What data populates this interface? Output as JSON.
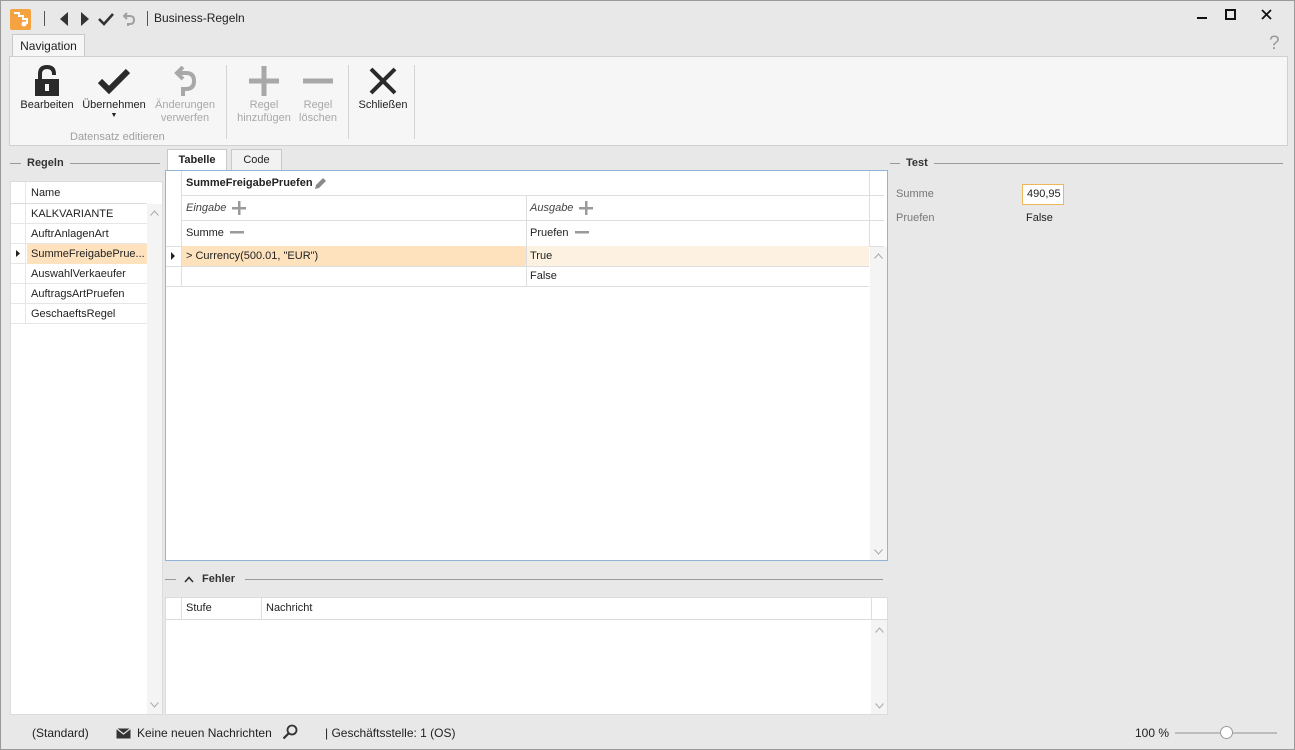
{
  "window": {
    "title": "Business-Regeln",
    "accent_color": "#f4a340"
  },
  "ribbon": {
    "tab": "Navigation",
    "buttons": {
      "edit": "Bearbeiten",
      "apply": "Übernehmen",
      "discard_line1": "Änderungen",
      "discard_line2": "verwerfen",
      "add_rule_line1": "Regel",
      "add_rule_line2": "hinzufügen",
      "delete_rule_line1": "Regel",
      "delete_rule_line2": "löschen",
      "close": "Schließen"
    },
    "group_label": "Datensatz editieren"
  },
  "rules_panel": {
    "header": "Regeln",
    "column": "Name",
    "items": [
      "KALKVARIANTE",
      "AuftrAnlagenArt",
      "SummeFreigabePruefen",
      "AuswahlVerkaeufer",
      "AuftragsArtPruefen",
      "GeschaeftsRegel"
    ],
    "selected_display": "SummeFreigabePrue..."
  },
  "tabs": [
    "Tabelle",
    "Code"
  ],
  "decision_table": {
    "name": "SummeFreigabePruefen",
    "input_label": "Eingabe",
    "output_label": "Ausgabe",
    "input_column": "Summe",
    "output_column": "Pruefen",
    "rows": [
      {
        "input": "> Currency(500.01, \"EUR\")",
        "output": "True"
      },
      {
        "input": "",
        "output": "False"
      }
    ],
    "selected_color": "#fde2bd"
  },
  "errors": {
    "header": "Fehler",
    "columns": [
      "Stufe",
      "Nachricht"
    ]
  },
  "test": {
    "header": "Test",
    "fields": [
      {
        "label": "Summe",
        "value": "490,95"
      },
      {
        "label": "Pruefen",
        "value": "False"
      }
    ]
  },
  "statusbar": {
    "profile": "(Standard)",
    "messages": "Keine neuen Nachrichten",
    "branch": "| Geschäftsstelle:  1 (OS)",
    "zoom": "100 %",
    "zoom_level": 50
  }
}
